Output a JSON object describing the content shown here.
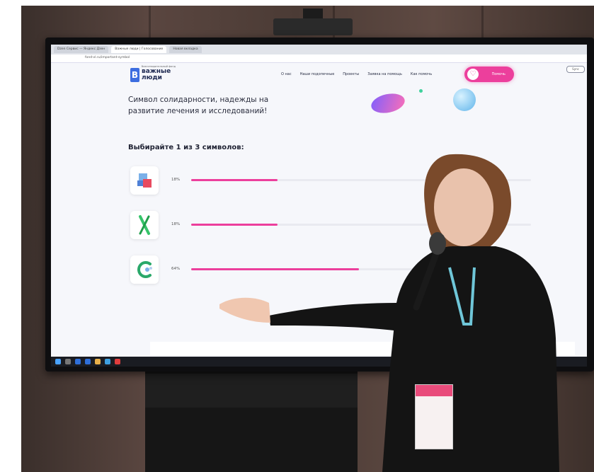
{
  "browser": {
    "tabs": [
      "Dzen Сервис — Яндекс Дзен",
      "Важные люди | Голосование",
      "Новая вкладка"
    ],
    "url": "fond-vl.ru/important-symbol",
    "profile_label": "Sync"
  },
  "site": {
    "logo_tagline": "благотворительный фонд",
    "logo_line1": "важные",
    "logo_line2": "люди",
    "nav": [
      "О нас",
      "Наши подопечные",
      "Проекты",
      "Заявка на помощь",
      "Как помочь"
    ],
    "donate_label": "Помочь"
  },
  "content": {
    "headline": "Символ солидарности, надежды на развитие лечения и исследований!",
    "choose_label": "Выбирайте 1 из 3 символов:",
    "options": [
      {
        "icon": "cube-symbol-icon",
        "percent_label": "18%",
        "share": 0.18,
        "color": "#ec3f9c"
      },
      {
        "icon": "green-ribbon-symbol-icon",
        "percent_label": "18%",
        "share": 0.18,
        "color": "#ec3f9c"
      },
      {
        "icon": "swirl-symbol-icon",
        "percent_label": "64%",
        "share": 0.64,
        "color": "#ec3f9c"
      }
    ]
  },
  "colors": {
    "accent": "#ec3f9c",
    "brand_blue": "#3c6de0",
    "jacket": "#141414",
    "hair": "#7a4a2b"
  }
}
